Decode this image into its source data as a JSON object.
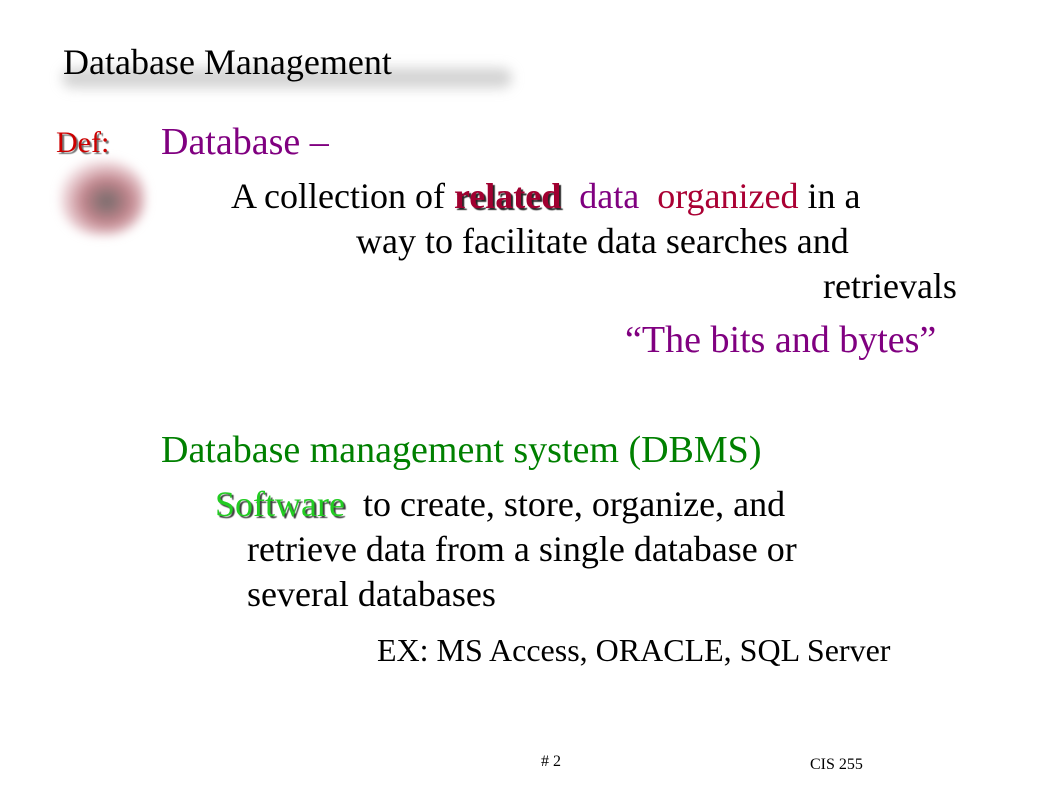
{
  "slide": {
    "title": "Database Management",
    "def_label": "Def:",
    "definitions": [
      {
        "term": "Database –",
        "description": {
          "line1": {
            "prefix": "A collection of ",
            "emphasis1": "related",
            "emphasis2": "data",
            "emphasis3": "organized",
            "suffix": " in a"
          },
          "line2": "way to facilitate data searches and",
          "line3": "retrievals"
        },
        "note": "“The bits and bytes”"
      },
      {
        "term": "Database management system (DBMS)",
        "description": {
          "line1": {
            "emphasis": "Software",
            "suffix": "  to create, store, organize, and"
          },
          "line2": "retrieve data from a single database or",
          "line3": "several databases"
        },
        "examples": "EX: MS Access, ORACLE, SQL Server"
      }
    ],
    "footer": {
      "page_number": "# 2",
      "course": "CIS 255"
    },
    "colors": {
      "def_label": "#cc0000",
      "database_term": "#800080",
      "related_word": "#a00030",
      "organized_word": "#aa0033",
      "dbms_term": "#008000",
      "software_word": "#22cc22"
    }
  }
}
